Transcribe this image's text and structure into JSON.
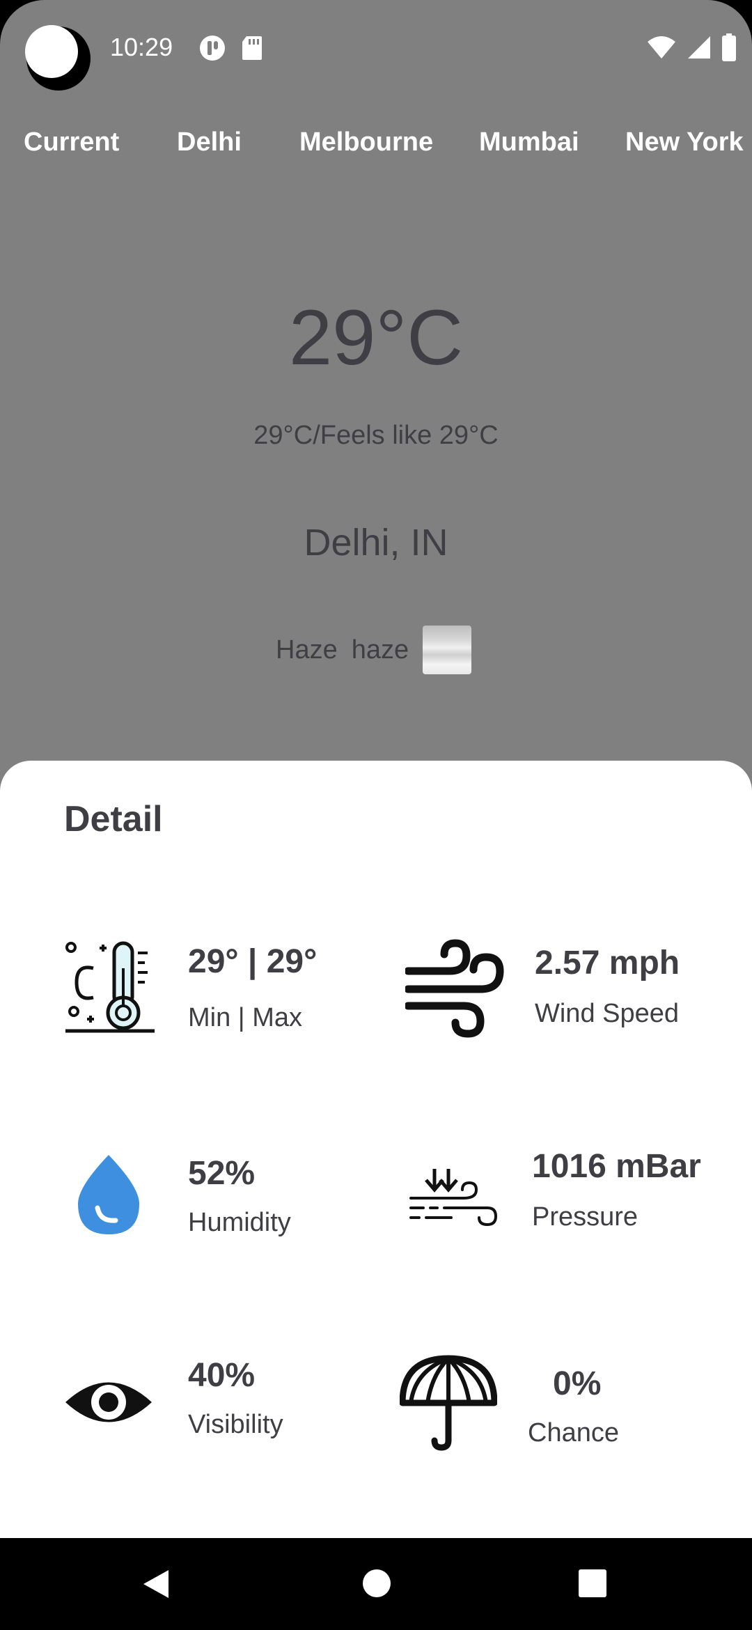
{
  "status_bar": {
    "time": "10:29",
    "left_icons": [
      "moon-avatar-icon",
      "app-notification-icon",
      "sd-card-icon"
    ],
    "right_icons": [
      "wifi-icon",
      "signal-icon",
      "battery-icon"
    ]
  },
  "tabs": [
    {
      "label": "Current"
    },
    {
      "label": "Delhi"
    },
    {
      "label": "Melbourne"
    },
    {
      "label": "Mumbai"
    },
    {
      "label": "New York"
    }
  ],
  "weather": {
    "temperature": "29°C",
    "feels_like": "29°C/Feels like 29°C",
    "location": "Delhi, IN",
    "condition_main": "Haze",
    "condition_desc": "haze",
    "condition_icon": "haze-icon"
  },
  "detail": {
    "title": "Detail",
    "items": [
      {
        "value": "29° | 29°",
        "label": "Min | Max",
        "icon": "thermometer-icon"
      },
      {
        "value": "2.57 mph",
        "label": "Wind Speed",
        "icon": "wind-icon"
      },
      {
        "value": "52%",
        "label": "Humidity",
        "icon": "water-drop-icon"
      },
      {
        "value": "1016 mBar",
        "label": "Pressure",
        "icon": "pressure-icon"
      },
      {
        "value": "40%",
        "label": "Visibility",
        "icon": "eye-icon"
      },
      {
        "value": "0%",
        "label": "Chance",
        "icon": "umbrella-icon"
      }
    ]
  },
  "colors": {
    "background": "#808080",
    "text_dark": "#3f3e44",
    "humidity_blue": "#3e8fe0"
  },
  "nav_bar": {
    "buttons": [
      "back-icon",
      "home-icon",
      "recents-icon"
    ]
  }
}
